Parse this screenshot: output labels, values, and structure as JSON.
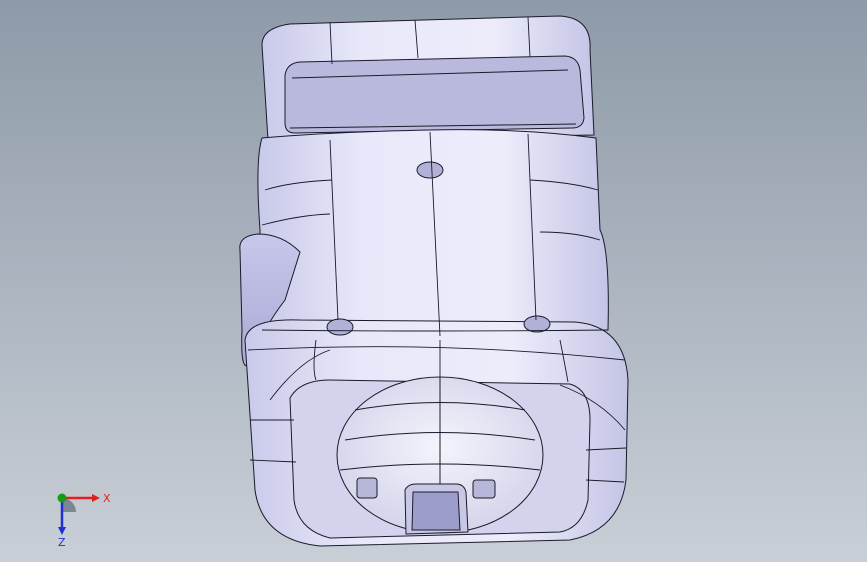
{
  "scene": {
    "background_top": "#8e9aa8",
    "background_bottom": "#c9cfd6",
    "part_fill": "#dcdcf4",
    "edge_color": "#1a1a2a"
  },
  "triad": {
    "x_label": "X",
    "z_label": "Z",
    "x_color": "#e02020",
    "y_color": "#10a010",
    "z_color": "#2030d0"
  }
}
